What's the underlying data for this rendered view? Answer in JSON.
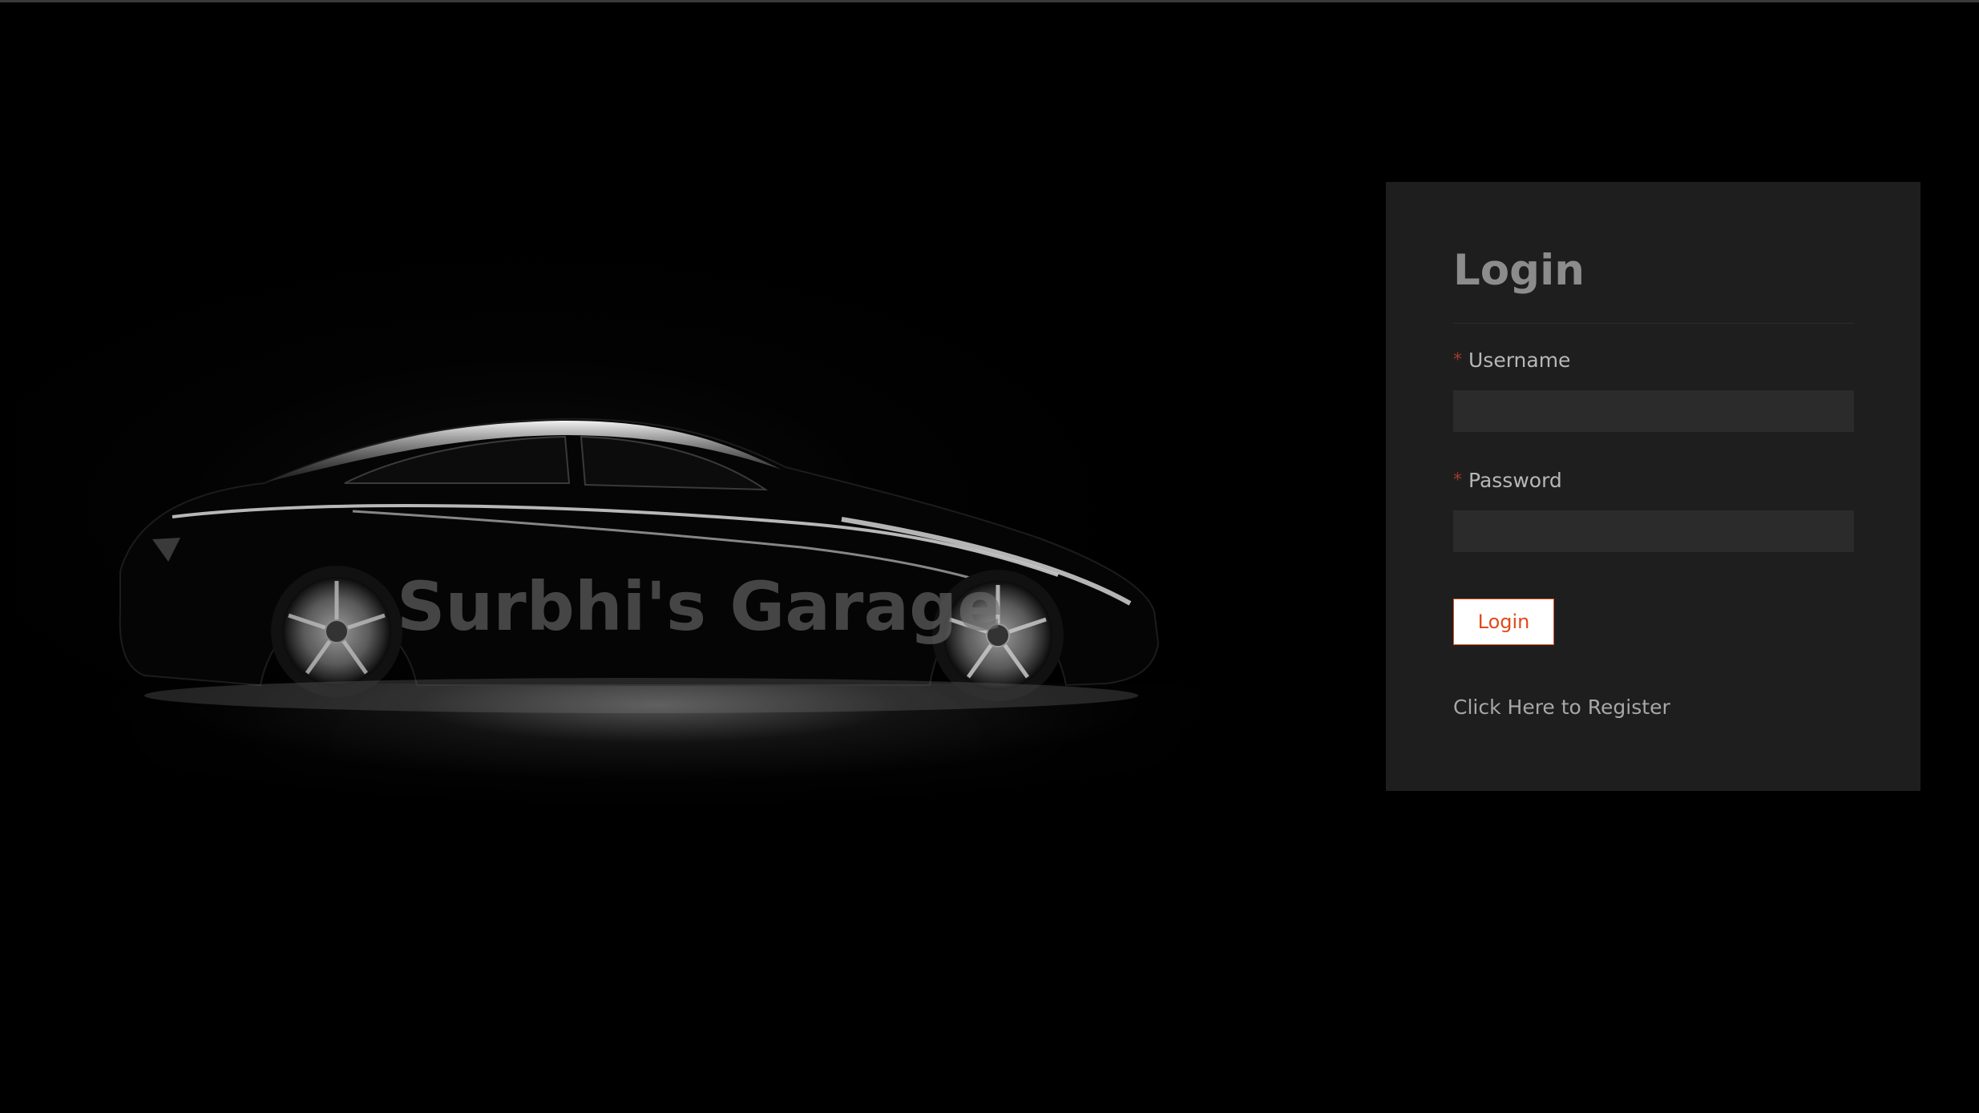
{
  "hero": {
    "title": "Surbhi's Garage",
    "image_alt": "black-sedan-photo"
  },
  "login": {
    "title": "Login",
    "required_marker": "*",
    "username_label": "Username",
    "username_value": "",
    "password_label": "Password",
    "password_value": "",
    "submit_label": "Login",
    "register_link": "Click Here to Register"
  },
  "colors": {
    "background": "#000000",
    "panel": "#1e1e1e",
    "input": "#2b2b2b",
    "accent": "#e04a1c",
    "required": "#a33a2e"
  }
}
